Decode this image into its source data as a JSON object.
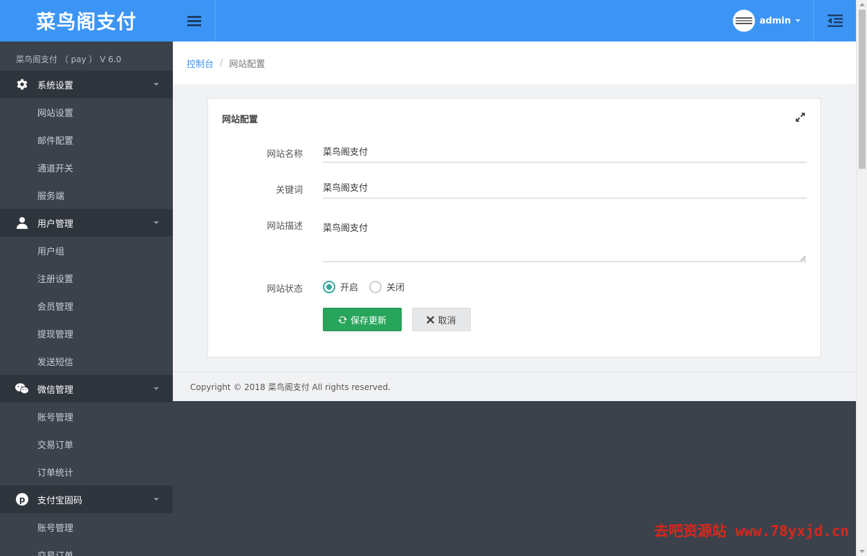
{
  "brand": {
    "title": "菜鸟阁支付",
    "version": "菜鸟阁支付 （ pay ） V 6.0"
  },
  "header": {
    "username": "admin"
  },
  "sidebar": {
    "groups": [
      {
        "label": "系统设置",
        "icon": "gear-icon",
        "items": [
          "网站设置",
          "邮件配置",
          "通道开关",
          "服务端"
        ]
      },
      {
        "label": "用户管理",
        "icon": "user-icon",
        "items": [
          "用户组",
          "注册设置",
          "会员管理",
          "提现管理",
          "发送短信"
        ]
      },
      {
        "label": "微信管理",
        "icon": "wechat-icon",
        "items": [
          "账号管理",
          "交易订单",
          "订单统计"
        ]
      },
      {
        "label": "支付宝固码",
        "icon": "pinterest-icon",
        "items": [
          "账号管理",
          "交易订单"
        ]
      }
    ]
  },
  "breadcrumb": {
    "home": "控制台",
    "separator": "/",
    "current": "网站配置"
  },
  "panel": {
    "title": "网站配置",
    "fields": {
      "name": {
        "label": "网站名称",
        "value": "菜鸟阁支付"
      },
      "keywords": {
        "label": "关键词",
        "value": "菜鸟阁支付"
      },
      "description": {
        "label": "网站描述",
        "value": "菜鸟阁支付"
      },
      "status": {
        "label": "网站状态",
        "options": [
          "开启",
          "关闭"
        ],
        "selected": "开启"
      }
    },
    "buttons": {
      "save": "保存更新",
      "cancel": "取消"
    }
  },
  "footer": {
    "copyright": "Copyright © 2018 菜鸟阁支付 All rights reserved."
  },
  "watermark": {
    "text": "去吧资源站 www.78yxjd.cn"
  },
  "colors": {
    "primary": "#3c95f5",
    "sidebar": "#3b424c",
    "sidebar_header": "#2f353d",
    "success": "#27a55b",
    "radio": "#2eaa9b",
    "watermark": "#d9271c"
  }
}
